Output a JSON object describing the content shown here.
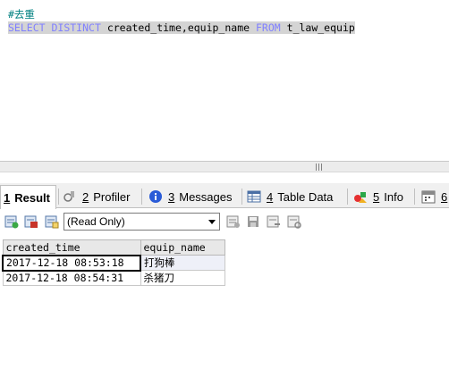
{
  "editor": {
    "comment": "#去重",
    "query_keyword_select": "SELECT",
    "query_keyword_distinct": "DISTINCT",
    "query_columns": "created_time,equip_name",
    "query_keyword_from": "FROM",
    "query_table": "t_law_equip"
  },
  "tabs": [
    {
      "num": "1",
      "label": "Result",
      "icon": "result-icon",
      "active": true
    },
    {
      "num": "2",
      "label": "Profiler",
      "icon": "profiler-icon"
    },
    {
      "num": "3",
      "label": "Messages",
      "icon": "info-icon"
    },
    {
      "num": "4",
      "label": "Table Data",
      "icon": "table-icon"
    },
    {
      "num": "5",
      "label": "Info",
      "icon": "info-shapes-icon"
    },
    {
      "num": "6",
      "label": "",
      "icon": "calendar-icon"
    }
  ],
  "toolbar": {
    "mode_select": "(Read Only)"
  },
  "results": {
    "columns": [
      "created_time",
      "equip_name"
    ],
    "rows": [
      [
        "2017-12-18 08:53:18",
        "打狗棒"
      ],
      [
        "2017-12-18 08:54:31",
        "杀猪刀"
      ]
    ]
  },
  "colors": {
    "keyword": "#8080ff",
    "comment": "#008080",
    "selection": "#d4d4d4"
  }
}
